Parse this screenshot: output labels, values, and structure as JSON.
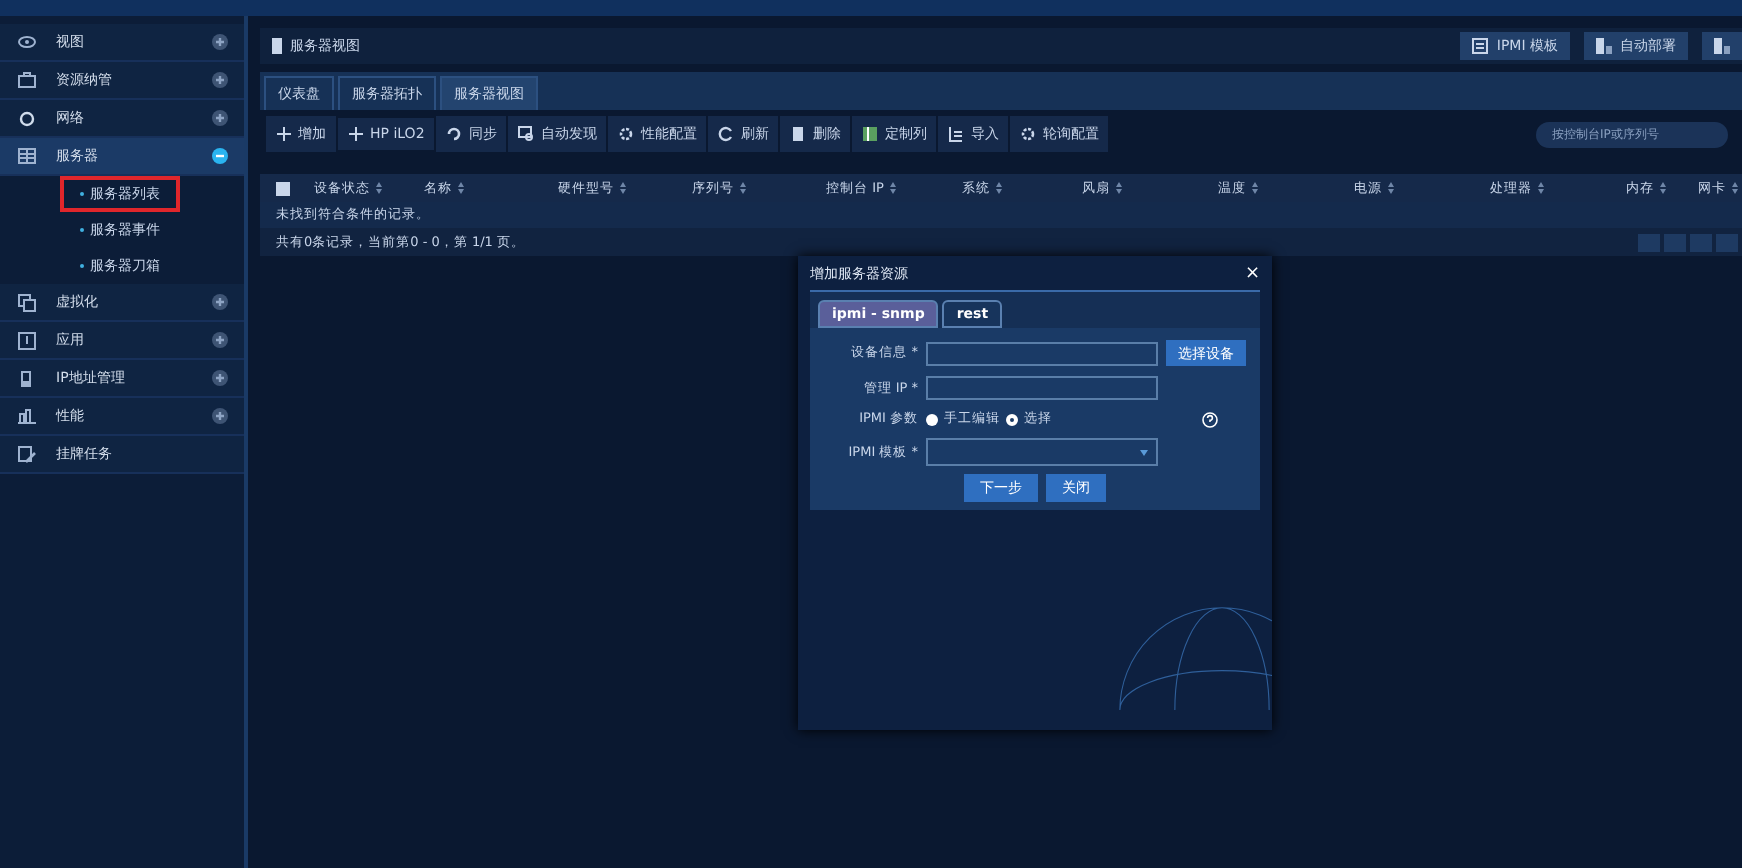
{
  "sidebar": {
    "items": [
      {
        "label": "视图",
        "expanded": false
      },
      {
        "label": "资源纳管",
        "expanded": false
      },
      {
        "label": "网络",
        "expanded": false
      },
      {
        "label": "服务器",
        "expanded": true,
        "children": [
          {
            "label": "服务器列表",
            "selected": true
          },
          {
            "label": "服务器事件",
            "selected": false
          },
          {
            "label": "服务器刀箱",
            "selected": false
          }
        ]
      },
      {
        "label": "虚拟化",
        "expanded": false
      },
      {
        "label": "应用",
        "expanded": false
      },
      {
        "label": "IP地址管理",
        "expanded": false
      },
      {
        "label": "性能",
        "expanded": false
      },
      {
        "label": "挂牌任务"
      }
    ]
  },
  "header": {
    "title": "服务器视图",
    "buttons": [
      "IPMI 模板",
      "自动部署"
    ]
  },
  "tabs": [
    {
      "label": "仪表盘",
      "selected": false
    },
    {
      "label": "服务器拓扑",
      "selected": false
    },
    {
      "label": "服务器视图",
      "selected": true
    }
  ],
  "toolbar": [
    "增加",
    "HP iLO2",
    "同步",
    "自动发现",
    "性能配置",
    "刷新",
    "删除",
    "定制列",
    "导入",
    "轮询配置"
  ],
  "search": {
    "placeholder": "按控制台IP或序列号"
  },
  "table": {
    "select_all_checked": false,
    "columns": [
      "设备状态",
      "名称",
      "硬件型号",
      "序列号",
      "控制台 IP",
      "系统",
      "风扇",
      "温度",
      "电源",
      "处理器",
      "内存",
      "网卡"
    ],
    "empty_message": "未找到符合条件的记录。",
    "footer": "共有0条记录，当前第0 - 0，第 1/1 页。"
  },
  "dialog": {
    "title": "增加服务器资源",
    "close": "×",
    "tabs": [
      {
        "label": "ipmi - snmp",
        "selected": true
      },
      {
        "label": "rest",
        "selected": false
      }
    ],
    "device_label": "设备信息 *",
    "select_button": "选择设备",
    "ip_label": "管理 IP *",
    "param_label": "IPMI 参数",
    "radios": [
      {
        "label": "手工编辑",
        "selected": false
      },
      {
        "label": "选择",
        "selected": true
      }
    ],
    "template_label": "IPMI 模板 *",
    "buttons": [
      "下一步",
      "关闭"
    ]
  }
}
